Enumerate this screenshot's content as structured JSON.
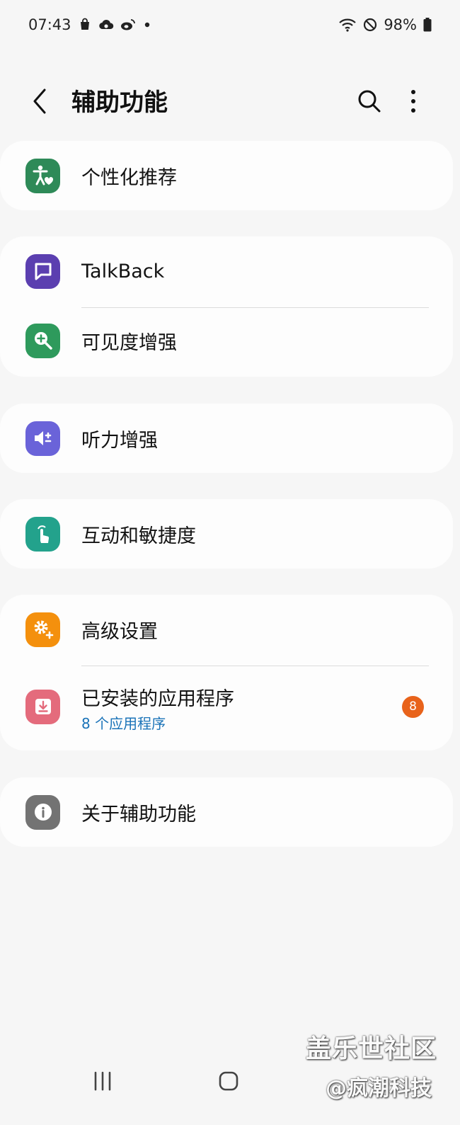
{
  "status_bar": {
    "time": "07:43",
    "battery": "98%",
    "left_icons": [
      "shopping-bag-icon",
      "cloud-sync-icon",
      "weibo-icon",
      "notification-dot-icon"
    ],
    "right_icons": [
      "wifi-icon",
      "do-not-disturb-icon",
      "battery-icon"
    ]
  },
  "appbar": {
    "title": "辅助功能",
    "icons": [
      "back-arrow-icon",
      "search-icon",
      "more-vertical-icon"
    ]
  },
  "groups": [
    {
      "items": [
        {
          "label": "个性化推荐",
          "icon": "accessibility-person-heart-icon",
          "color": "#2e8a58"
        }
      ]
    },
    {
      "items": [
        {
          "label": "TalkBack",
          "icon": "talkback-chat-icon",
          "color": "#5b3fb0"
        },
        {
          "label": "可见度增强",
          "icon": "magnifier-plus-icon",
          "color": "#2e9a5c"
        }
      ]
    },
    {
      "items": [
        {
          "label": "听力增强",
          "icon": "hearing-speaker-icon",
          "color": "#6a63d9"
        }
      ]
    },
    {
      "items": [
        {
          "label": "互动和敏捷度",
          "icon": "touch-hand-icon",
          "color": "#23a28c"
        }
      ]
    },
    {
      "items": [
        {
          "label": "高级设置",
          "icon": "gear-plus-icon",
          "color": "#f4900d"
        },
        {
          "label": "已安装的应用程序",
          "subtitle": "8 个应用程序",
          "badge": "8",
          "icon": "download-box-icon",
          "color": "#e46b7c"
        }
      ]
    },
    {
      "items": [
        {
          "label": "关于辅助功能",
          "icon": "info-icon",
          "color": "#737373"
        }
      ]
    }
  ],
  "watermark": {
    "line1": "盖乐世社区",
    "line2": "@疯潮科技"
  },
  "navbar": {
    "icons": [
      "recent-apps-icon",
      "home-icon"
    ]
  }
}
